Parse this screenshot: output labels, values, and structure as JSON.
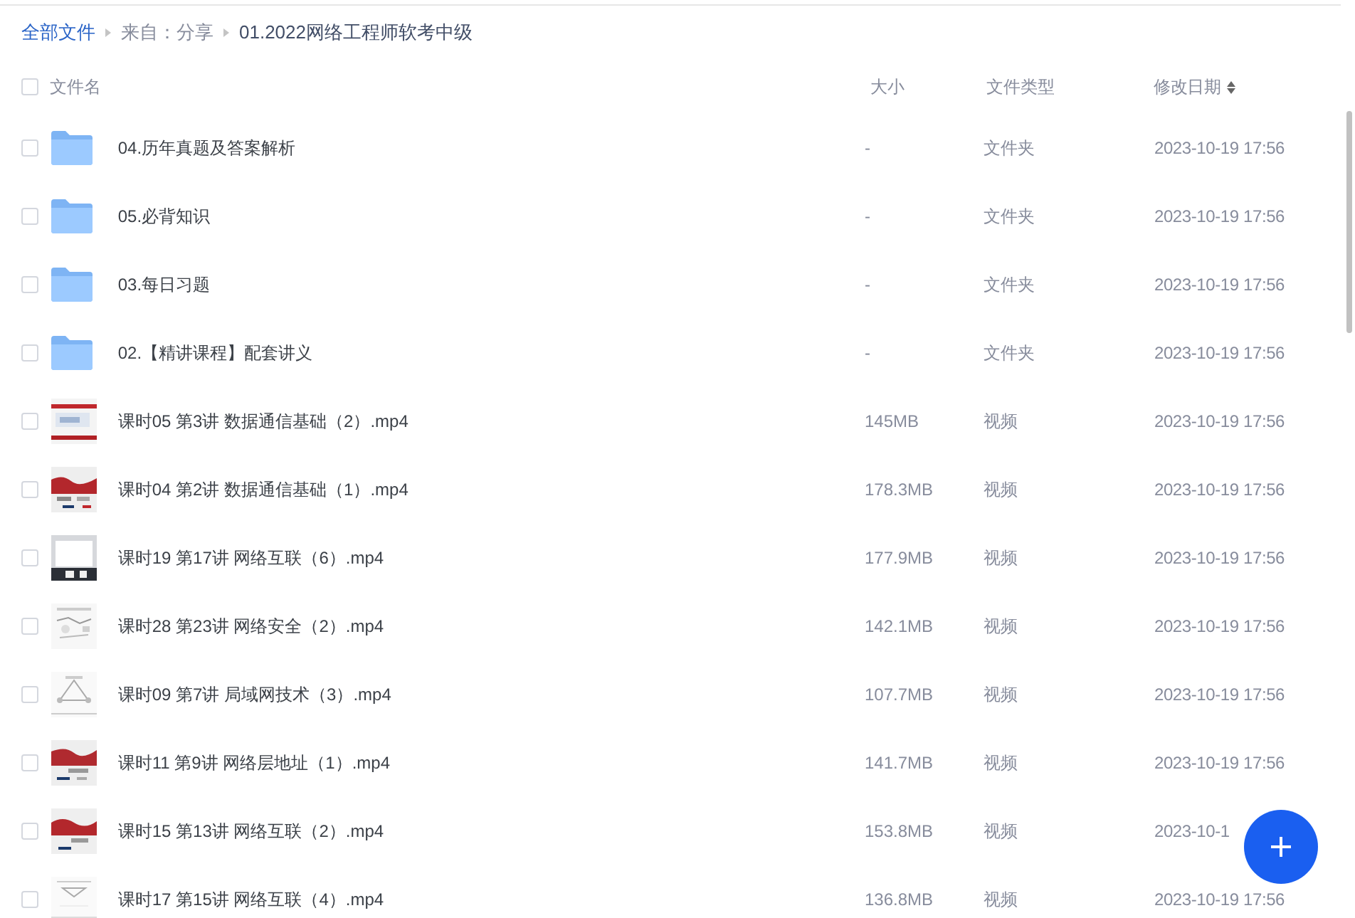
{
  "breadcrumb": [
    {
      "label": "全部文件",
      "link": true
    },
    {
      "label": "来自：分享",
      "link": false
    },
    {
      "label": "01.2022网络工程师软考中级",
      "link": false
    }
  ],
  "select_all": {
    "checked": false
  },
  "columns": [
    {
      "label": "文件名"
    },
    {
      "label": "大小"
    },
    {
      "label": "文件类型"
    },
    {
      "label": "修改日期",
      "sortable": true
    }
  ],
  "rows": [
    {
      "kind": "folder",
      "name": "04.历年真题及答案解析",
      "size": "-",
      "type": "文件夹",
      "date": "2023-10-19 17:56",
      "checked": false
    },
    {
      "kind": "folder",
      "name": "05.必背知识",
      "size": "-",
      "type": "文件夹",
      "date": "2023-10-19 17:56",
      "checked": false
    },
    {
      "kind": "folder",
      "name": "03.每日习题",
      "size": "-",
      "type": "文件夹",
      "date": "2023-10-19 17:56",
      "checked": false
    },
    {
      "kind": "folder",
      "name": "02.【精讲课程】配套讲义",
      "size": "-",
      "type": "文件夹",
      "date": "2023-10-19 17:56",
      "checked": false
    },
    {
      "kind": "video",
      "name": "课时05 第3讲 数据通信基础（2）.mp4",
      "size": "145MB",
      "type": "视频",
      "date": "2023-10-19 17:56",
      "checked": false
    },
    {
      "kind": "video",
      "name": "课时04 第2讲 数据通信基础（1）.mp4",
      "size": "178.3MB",
      "type": "视频",
      "date": "2023-10-19 17:56",
      "checked": false
    },
    {
      "kind": "video",
      "name": "课时19 第17讲 网络互联（6）.mp4",
      "size": "177.9MB",
      "type": "视频",
      "date": "2023-10-19 17:56",
      "checked": false
    },
    {
      "kind": "video",
      "name": "课时28 第23讲 网络安全（2）.mp4",
      "size": "142.1MB",
      "type": "视频",
      "date": "2023-10-19 17:56",
      "checked": false
    },
    {
      "kind": "video",
      "name": "课时09 第7讲 局域网技术（3）.mp4",
      "size": "107.7MB",
      "type": "视频",
      "date": "2023-10-19 17:56",
      "checked": false
    },
    {
      "kind": "video",
      "name": "课时11 第9讲 网络层地址（1）.mp4",
      "size": "141.7MB",
      "type": "视频",
      "date": "2023-10-19 17:56",
      "checked": false
    },
    {
      "kind": "video",
      "name": "课时15 第13讲 网络互联（2）.mp4",
      "size": "153.8MB",
      "type": "视频",
      "date": "2023-10-1",
      "checked": false
    },
    {
      "kind": "video",
      "name": "课时17 第15讲 网络互联（4）.mp4",
      "size": "136.8MB",
      "type": "视频",
      "date": "2023-10-19 17:56",
      "checked": false
    }
  ]
}
